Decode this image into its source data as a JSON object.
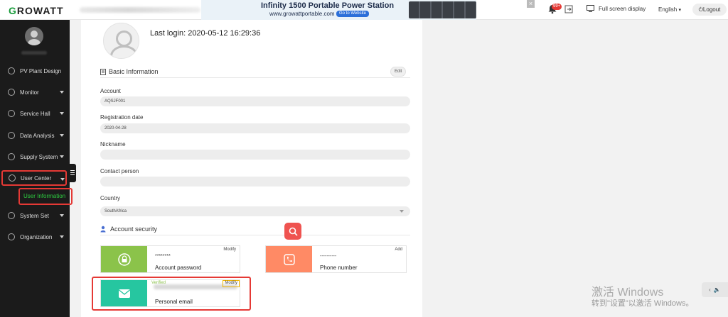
{
  "topbar": {
    "logo": "GROWATT",
    "ad_title": "Infinity 1500 Portable Power Station",
    "ad_url": "www.growattportable.com",
    "ad_button": "Go to Website",
    "ad_close": "×",
    "notification_count": "99+",
    "fullscreen_label": "Full screen display",
    "language": "English",
    "logout": "Logout"
  },
  "sidebar": {
    "items": [
      {
        "label": "PV Plant Design",
        "icon": "pv-icon"
      },
      {
        "label": "Monitor",
        "icon": "monitor-icon"
      },
      {
        "label": "Service Hall",
        "icon": "service-icon"
      },
      {
        "label": "Data Analysis",
        "icon": "chart-icon"
      },
      {
        "label": "Supply System",
        "icon": "supply-icon"
      },
      {
        "label": "User Center",
        "icon": "user-icon"
      },
      {
        "label": "System Set",
        "icon": "settings-icon"
      },
      {
        "label": "Organization",
        "icon": "organization-icon"
      }
    ],
    "sub_item": "User Information"
  },
  "profile": {
    "last_login": "Last login: 2020-05-12 16:29:36"
  },
  "basic_info": {
    "title": "Basic Information",
    "edit": "Edit",
    "account_label": "Account",
    "account_value": "AQSJF001",
    "registration_label": "Registration date",
    "registration_value": "2020-04-28",
    "nickname_label": "Nickname",
    "nickname_value": "",
    "contact_label": "Contact person",
    "contact_value": "",
    "country_label": "Country",
    "country_value": "SouthAfrica"
  },
  "security": {
    "title": "Account security",
    "password": {
      "value": "********",
      "label": "Account password",
      "action": "Modify",
      "color": "#8bc34a"
    },
    "phone": {
      "value": "----------",
      "label": "Phone number",
      "action": "Add",
      "color": "#ff8a65"
    },
    "email": {
      "status": "Verified",
      "label": "Personal email",
      "action": "Modify",
      "color": "#26c6a0"
    }
  },
  "watermark": {
    "line1": "激活 Windows",
    "line2": "转到\"设置\"以激活 Windows。"
  }
}
